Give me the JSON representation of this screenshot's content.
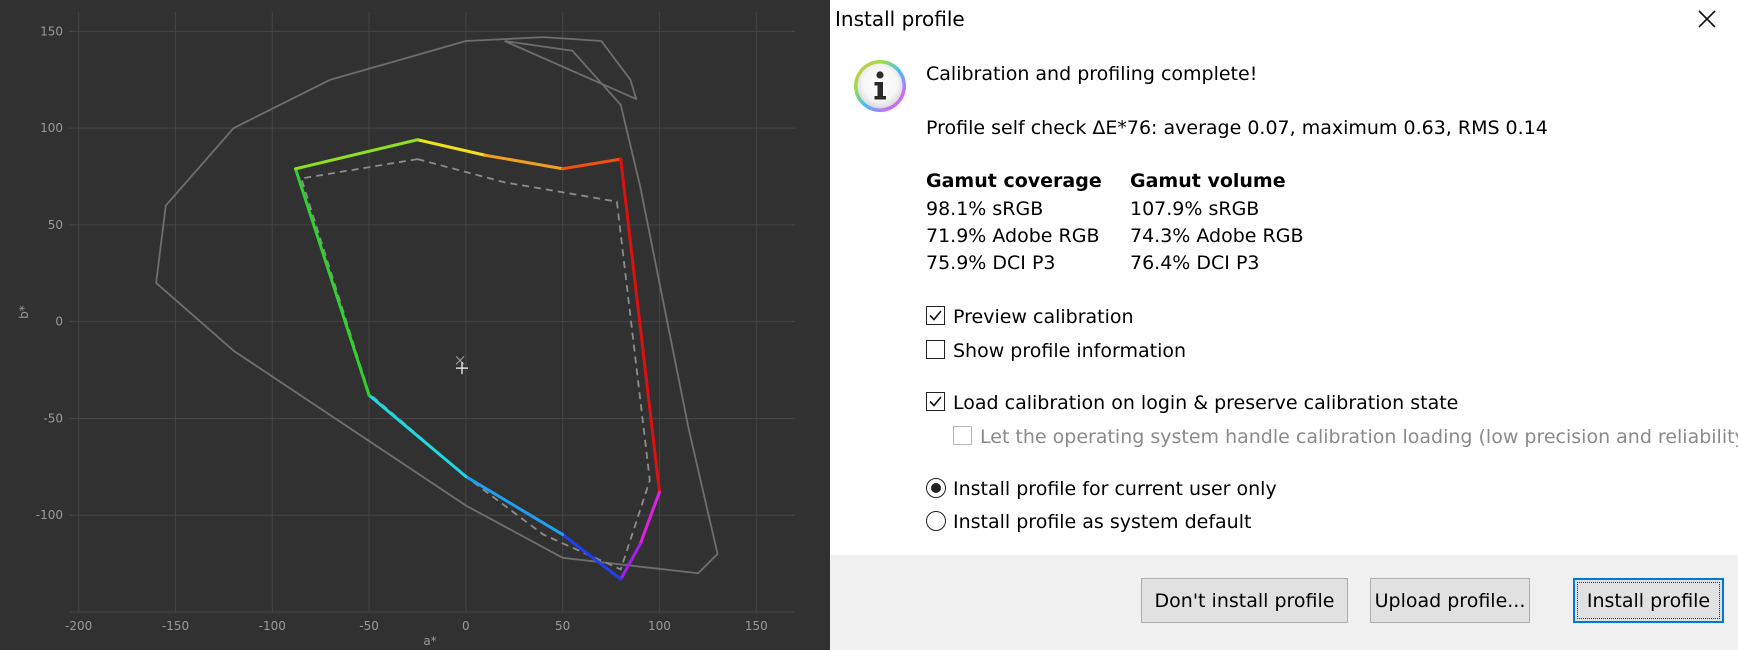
{
  "plot": {
    "x_ticks": [
      "-200",
      "-150",
      "-100",
      "-50",
      "0",
      "50",
      "100",
      "150"
    ],
    "y_ticks": [
      "150",
      "100",
      "50",
      "0",
      "-50",
      "-100"
    ],
    "xlabel": "a*",
    "ylabel": "b*",
    "colors": {
      "background": "#313131",
      "grid": "#454545",
      "reference_outline": "#6e6e6e",
      "target_dashed": "#8c8c8c",
      "red": "#e01010",
      "yellow": "#f0e020",
      "green": "#30d030",
      "cyan": "#20d8e0",
      "blue": "#2040f0",
      "magenta": "#e020e0"
    }
  },
  "chart_data": {
    "type": "line",
    "title": "",
    "xlabel": "a*",
    "ylabel": "b*",
    "xlim": [
      -205,
      170
    ],
    "ylim": [
      -150,
      160
    ],
    "grid": true,
    "series": [
      {
        "x": [
          -25,
          10,
          50,
          80,
          100,
          90,
          80,
          50,
          0,
          -50,
          -88,
          -25
        ],
        "y": [
          94,
          86,
          79,
          84,
          -88,
          -115,
          -133,
          -110,
          -80,
          -38,
          79,
          94
        ]
      },
      {
        "x": [
          -25,
          20,
          55,
          78,
          95,
          80,
          40,
          0,
          -50,
          -85,
          -25
        ],
        "y": [
          84,
          72,
          66,
          62,
          -82,
          -128,
          -110,
          -80,
          -37,
          74,
          84
        ]
      },
      {
        "x": [
          20,
          55,
          80,
          90,
          115,
          130,
          120,
          50,
          0,
          -60,
          -120,
          -160,
          -155,
          -120,
          -70,
          0,
          40,
          70,
          85,
          88,
          20
        ],
        "y": [
          145,
          140,
          112,
          70,
          -55,
          -120,
          -130,
          -122,
          -95,
          -55,
          -15,
          20,
          60,
          100,
          125,
          145,
          147,
          145,
          125,
          115,
          145
        ]
      },
      {
        "x": [
          -3,
          -2
        ],
        "y": [
          -20,
          -24
        ]
      }
    ]
  },
  "dialog": {
    "title": "Install profile",
    "heading": "Calibration and profiling complete!",
    "self_check": "Profile self check ΔE*76: average 0.07, maximum 0.63, RMS 0.14",
    "coverage": {
      "header": "Gamut coverage",
      "rows": [
        "98.1% sRGB",
        "71.9% Adobe RGB",
        "75.9% DCI P3"
      ]
    },
    "volume": {
      "header": "Gamut volume",
      "rows": [
        "107.9% sRGB",
        "74.3% Adobe RGB",
        "76.4% DCI P3"
      ]
    },
    "checkboxes": {
      "preview": {
        "label": "Preview calibration",
        "checked": true
      },
      "show_info": {
        "label": "Show profile information",
        "checked": false
      },
      "load_calibration": {
        "label": "Load calibration on login & preserve calibration state",
        "checked": true
      },
      "os_handle": {
        "label": "Let the operating system handle calibration loading (low precision and reliability)",
        "checked": false,
        "disabled": true
      }
    },
    "radios": {
      "current_user": {
        "label": "Install profile for current user only",
        "selected": true
      },
      "system_default": {
        "label": "Install profile as system default",
        "selected": false
      }
    },
    "buttons": {
      "dont_install": "Don't install profile",
      "upload": "Upload profile...",
      "install": "Install profile"
    },
    "icons": {
      "info": "info-icon",
      "close": "close-icon"
    }
  }
}
